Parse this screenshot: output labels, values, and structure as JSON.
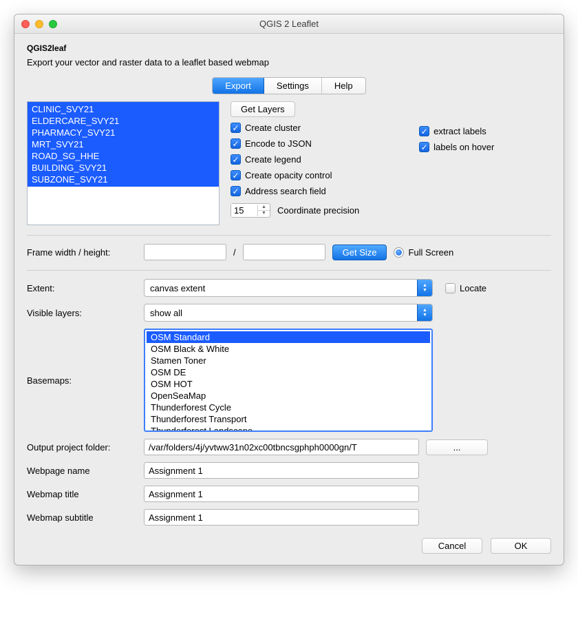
{
  "window": {
    "title": "QGIS 2 Leaflet"
  },
  "header": {
    "app_name": "QGIS2leaf",
    "subtitle": "Export your vector and raster data to a leaflet based webmap"
  },
  "tabs": {
    "export": "Export",
    "settings": "Settings",
    "help": "Help"
  },
  "layers": {
    "items": [
      "CLINIC_SVY21",
      "ELDERCARE_SVY21",
      "PHARMACY_SVY21",
      "MRT_SVY21",
      "ROAD_SG_HHE",
      "BUILDING_SVY21",
      "SUBZONE_SVY21"
    ]
  },
  "buttons": {
    "get_layers": "Get Layers",
    "get_size": "Get Size",
    "browse": "...",
    "cancel": "Cancel",
    "ok": "OK"
  },
  "checks_left": {
    "cluster": "Create cluster",
    "json": "Encode to JSON",
    "legend": "Create legend",
    "opacity": "Create opacity control",
    "search": "Address search field"
  },
  "checks_right": {
    "extract_labels": "extract labels",
    "labels_hover": "labels on hover"
  },
  "precision": {
    "value": "15",
    "label": "Coordinate precision"
  },
  "frame": {
    "label": "Frame width / height:",
    "width": "",
    "height": "",
    "sep": "/",
    "full_screen": "Full Screen"
  },
  "extent": {
    "label": "Extent:",
    "value": "canvas extent",
    "locate": "Locate"
  },
  "visible": {
    "label": "Visible layers:",
    "value": "show all"
  },
  "basemaps": {
    "label": "Basemaps:",
    "items": [
      "OSM Standard",
      "OSM Black & White",
      "Stamen Toner",
      "OSM DE",
      "OSM HOT",
      "OpenSeaMap",
      "Thunderforest Cycle",
      "Thunderforest Transport",
      "Thunderforest Landscape"
    ]
  },
  "output_folder": {
    "label": "Output project folder:",
    "value": "/var/folders/4j/yvtww31n02xc00tbncsgphph0000gn/T"
  },
  "webpage_name": {
    "label": "Webpage name",
    "value": "Assignment 1"
  },
  "webmap_title": {
    "label": "Webmap title",
    "value": "Assignment 1"
  },
  "webmap_subtitle": {
    "label": "Webmap subtitle",
    "value": "Assignment 1"
  }
}
